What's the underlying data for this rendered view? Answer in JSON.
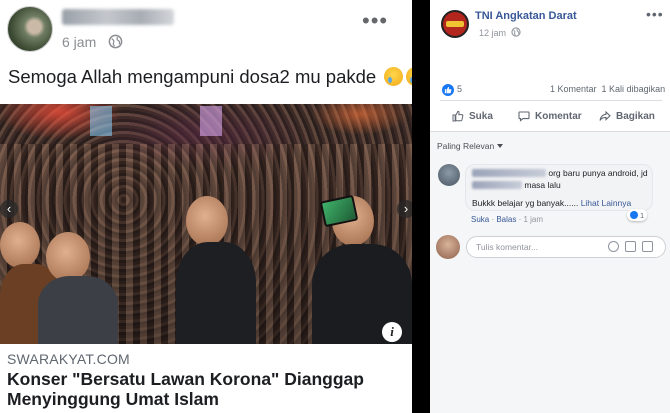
{
  "left_post": {
    "author_name": "Ajeng Larasati",
    "time": "6 jam",
    "caption": "Semoga Allah mengampuni dosa2 mu pakde",
    "emoji": [
      "crying-face",
      "crying-face",
      "crying-face"
    ],
    "link_source": "SWARAKYAT.COM",
    "link_title": "Konser \"Bersatu Lawan Korona\" Dianggap Menyinggung Umat Islam"
  },
  "right_post": {
    "page_name": "TNI Angkatan Darat",
    "time": "12 jam",
    "like_count": "5",
    "comments_count": "1 Komentar",
    "shares_count": "1 Kali dibagikan",
    "actions": {
      "like": "Suka",
      "comment": "Komentar",
      "share": "Bagikan"
    },
    "sort_label": "Paling Relevan",
    "comment": {
      "author_name": "Nur Santoso Iris",
      "text_line1": "org baru punya android, jd",
      "text_line2_blur": "gaya cerita",
      "text_line2": "masa lalu",
      "text_line3": "Bukkk belajar yg banyak......",
      "see_more": "Lihat Lainnya",
      "reaction_count": "1",
      "like_action": "Suka",
      "reply_action": "Balas",
      "time": "1 jam"
    },
    "write_comment_placeholder": "Tulis komentar..."
  },
  "colors": {
    "link_blue": "#385898",
    "like_blue": "#1877f2",
    "divider": "#000000"
  }
}
